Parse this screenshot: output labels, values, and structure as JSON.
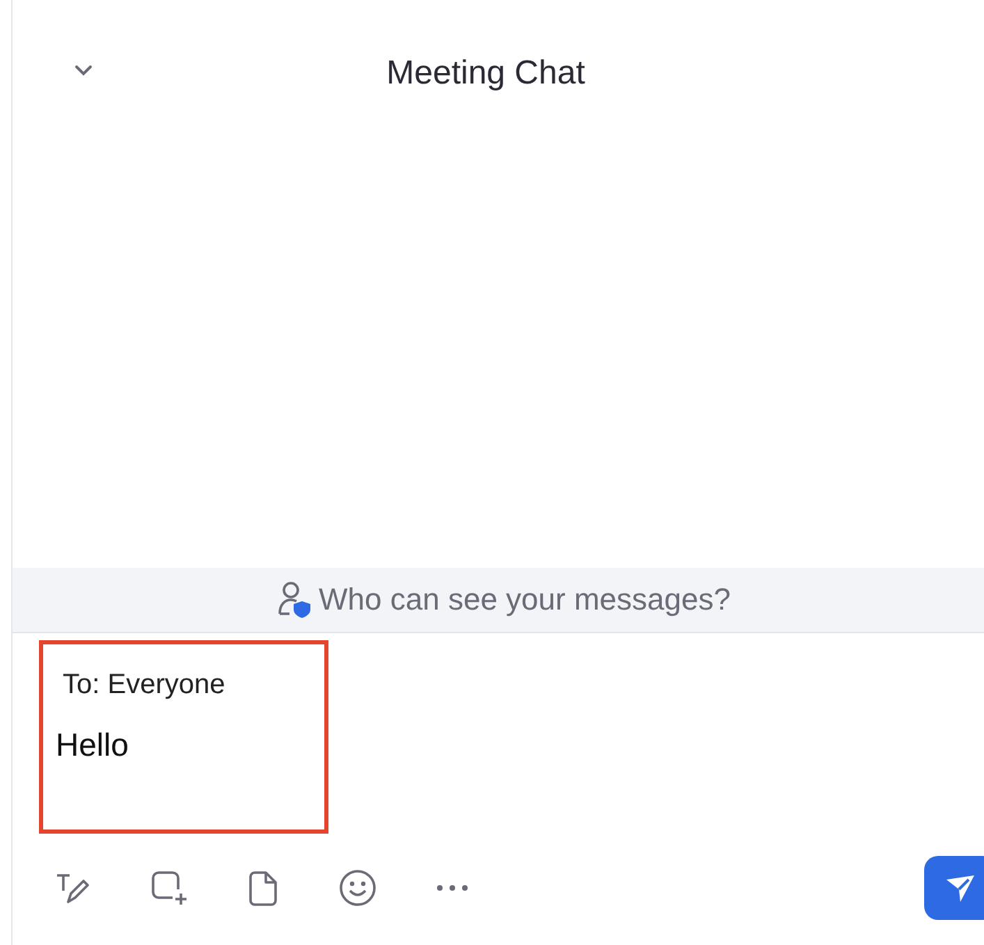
{
  "header": {
    "title": "Meeting Chat"
  },
  "privacy_banner": {
    "text": "Who can see your messages?"
  },
  "composer": {
    "recipient": "To: Everyone",
    "message": "Hello"
  }
}
